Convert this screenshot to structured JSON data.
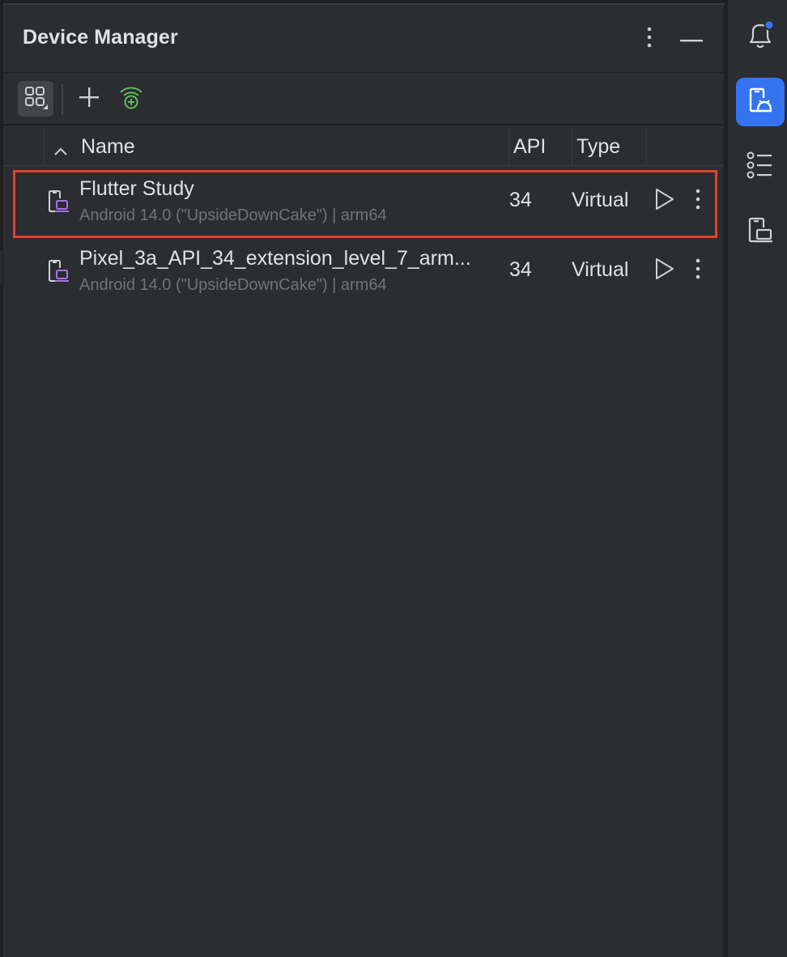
{
  "window": {
    "title": "Device Manager"
  },
  "header": {
    "options_icon": "vertical-ellipsis-icon",
    "hide_icon": "minimize-icon"
  },
  "toolbar": {
    "view_toggle_icon": "grid-view-icon",
    "add_icon": "plus-icon",
    "pair_wifi_icon": "wifi-pair-icon"
  },
  "table": {
    "columns": {
      "name": "Name",
      "api": "API",
      "type": "Type"
    },
    "sort_icon": "chevron-up-icon",
    "rows": [
      {
        "name": "Flutter Study",
        "subtitle": "Android 14.0 (\"UpsideDownCake\") | arm64",
        "api": "34",
        "type": "Virtual",
        "highlighted": true
      },
      {
        "name": "Pixel_3a_API_34_extension_level_7_arm...",
        "subtitle": "Android 14.0 (\"UpsideDownCake\") | arm64",
        "api": "34",
        "type": "Virtual",
        "highlighted": false
      }
    ]
  },
  "stripe": {
    "items": [
      {
        "icon": "notifications-bell-icon",
        "active": false,
        "badge": true
      },
      {
        "icon": "device-manager-icon",
        "active": true
      },
      {
        "icon": "structure-list-icon",
        "active": false
      },
      {
        "icon": "running-devices-icon",
        "active": false
      }
    ]
  },
  "colors": {
    "panel_bg": "#2b2d30",
    "window_bg": "#1e1f22",
    "text_primary": "#dfe1e5",
    "text_secondary": "#6f737a",
    "accent": "#3574f0",
    "highlight_border": "#e5412a",
    "device_icon_purple": "#a571e6",
    "wifi_green": "#5fb865"
  }
}
